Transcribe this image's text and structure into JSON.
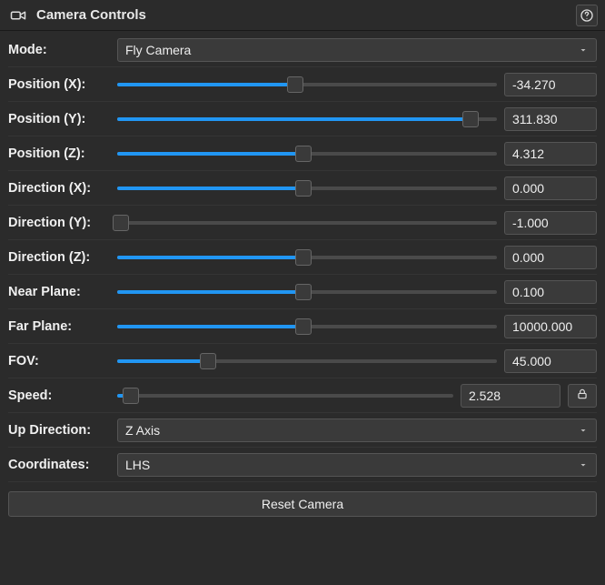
{
  "header": {
    "title": "Camera Controls"
  },
  "labels": {
    "mode": "Mode:",
    "posx": "Position (X):",
    "posy": "Position (Y):",
    "posz": "Position (Z):",
    "dirx": "Direction (X):",
    "diry": "Direction (Y):",
    "dirz": "Direction (Z):",
    "near": "Near Plane:",
    "far": "Far Plane:",
    "fov": "FOV:",
    "speed": "Speed:",
    "updir": "Up Direction:",
    "coords": "Coordinates:"
  },
  "mode": {
    "selected": "Fly Camera"
  },
  "position": {
    "x": {
      "value": "-34.270",
      "fill_pct": 47
    },
    "y": {
      "value": "311.830",
      "fill_pct": 93
    },
    "z": {
      "value": "4.312",
      "fill_pct": 49
    }
  },
  "direction": {
    "x": {
      "value": "0.000",
      "fill_pct": 49
    },
    "y": {
      "value": "-1.000",
      "fill_pct": 1
    },
    "z": {
      "value": "0.000",
      "fill_pct": 49
    }
  },
  "near_plane": {
    "value": "0.100",
    "fill_pct": 49
  },
  "far_plane": {
    "value": "10000.000",
    "fill_pct": 49
  },
  "fov": {
    "value": "45.000",
    "fill_pct": 24
  },
  "speed": {
    "value": "2.528",
    "fill_pct": 4
  },
  "up_direction": {
    "selected": "Z Axis"
  },
  "coordinates": {
    "selected": "LHS"
  },
  "reset_label": "Reset Camera"
}
